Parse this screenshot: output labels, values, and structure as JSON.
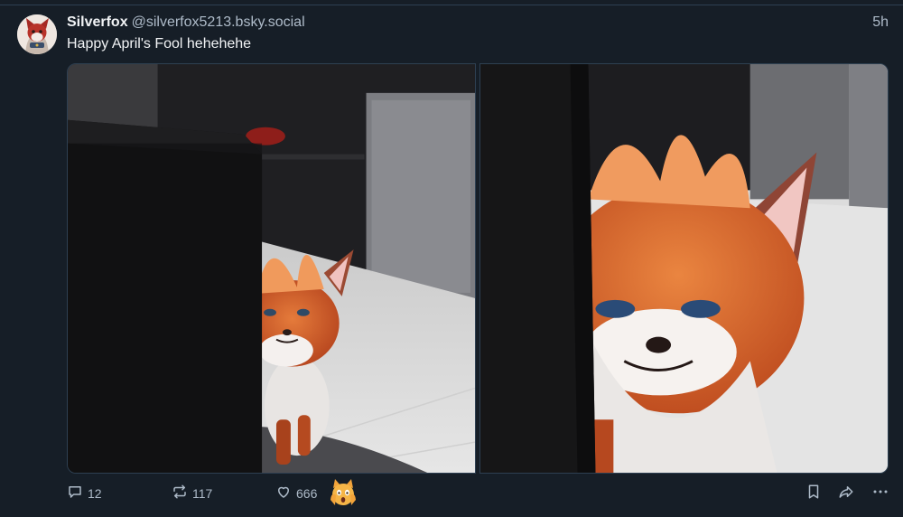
{
  "post": {
    "author": {
      "display_name": "Silverfox",
      "handle": "@silverfox5213.bsky.social"
    },
    "timestamp": "5h",
    "text": "Happy April's Fool hehehehe"
  },
  "actions": {
    "replies": "12",
    "reposts": "117",
    "likes": "666"
  },
  "icons": {
    "reply": "reply-icon",
    "repost": "repost-icon",
    "like": "heart-icon",
    "reaction": "scared-cat-emoji-icon",
    "bookmark": "bookmark-icon",
    "share": "share-icon",
    "more": "more-icon"
  },
  "colors": {
    "background": "#161e27",
    "text": "#f1f3f5",
    "muted": "#aebbc9",
    "border": "#2e4052",
    "fox_orange": "#d5612b"
  }
}
